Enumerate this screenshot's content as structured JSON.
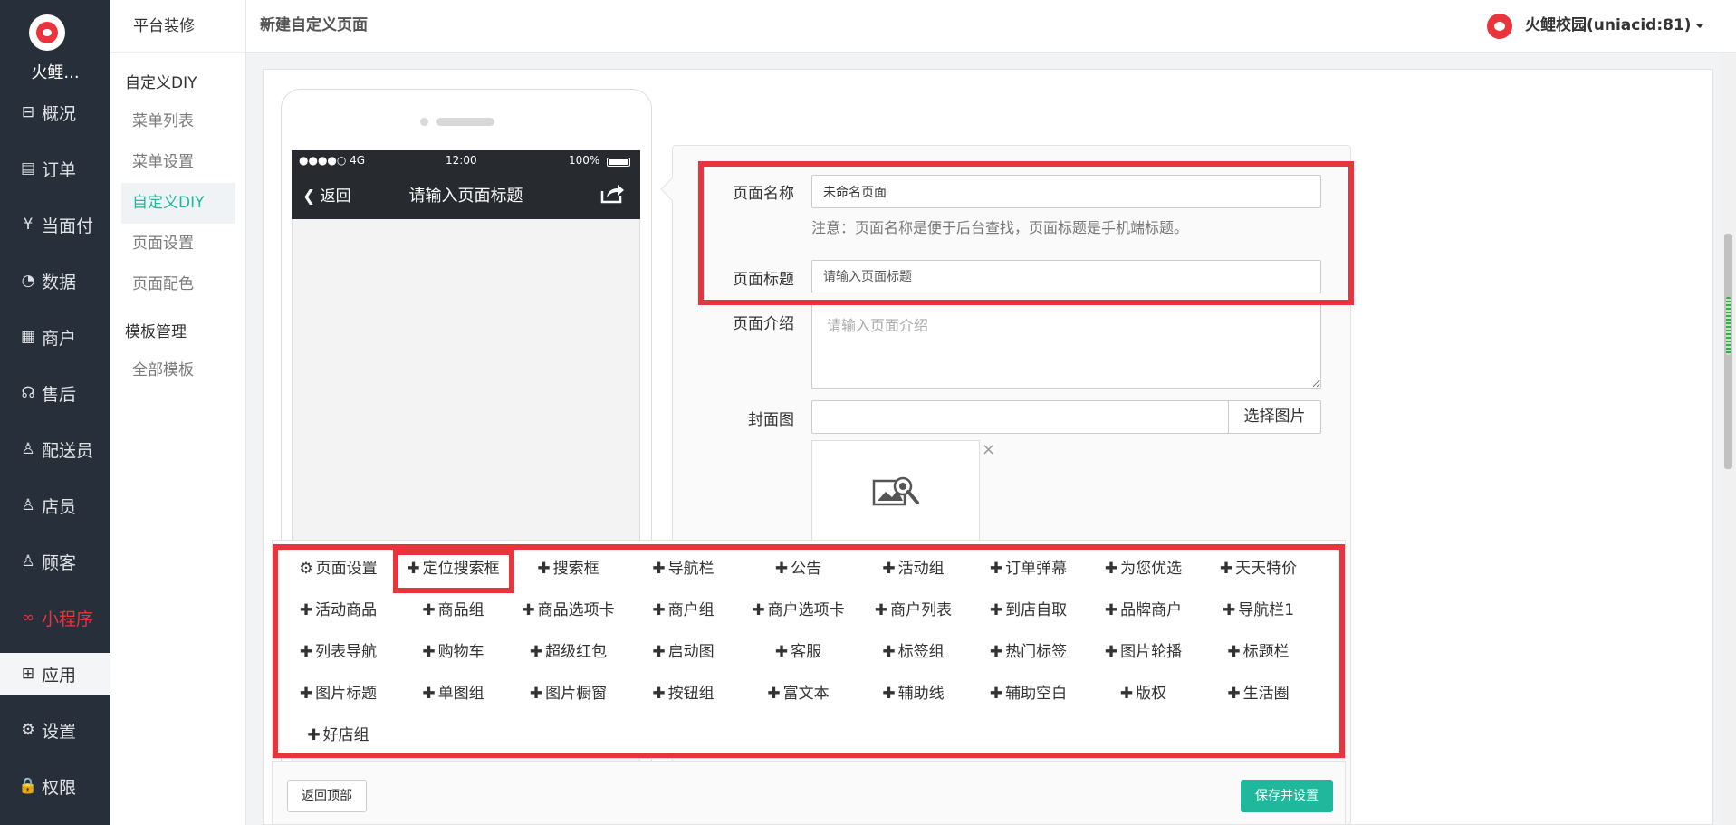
{
  "sidebar": {
    "brand": "火鲤...",
    "items": [
      {
        "label": "概况",
        "icon": "dashboard-icon",
        "glyph": "⊟"
      },
      {
        "label": "订单",
        "icon": "order-icon",
        "glyph": "▤"
      },
      {
        "label": "当面付",
        "icon": "yen-icon",
        "glyph": "¥"
      },
      {
        "label": "数据",
        "icon": "chart-icon",
        "glyph": "◔"
      },
      {
        "label": "商户",
        "icon": "store-icon",
        "glyph": "▦"
      },
      {
        "label": "售后",
        "icon": "service-icon",
        "glyph": "☊"
      },
      {
        "label": "配送员",
        "icon": "courier-icon",
        "glyph": "♙"
      },
      {
        "label": "店员",
        "icon": "clerk-icon",
        "glyph": "♙"
      },
      {
        "label": "顾客",
        "icon": "customer-icon",
        "glyph": "♙"
      },
      {
        "label": "小程序",
        "icon": "miniprogram-icon",
        "glyph": "∞"
      },
      {
        "label": "应用",
        "icon": "apps-icon",
        "glyph": "⊞"
      },
      {
        "label": "设置",
        "icon": "settings-icon",
        "glyph": "⚙"
      },
      {
        "label": "权限",
        "icon": "lock-icon",
        "glyph": "🔒"
      }
    ]
  },
  "subnav": {
    "title": "平台装修",
    "group1": "自定义DIY",
    "group1_items": [
      "菜单列表",
      "菜单设置",
      "自定义DIY",
      "页面设置",
      "页面配色"
    ],
    "group2": "模板管理",
    "group2_items": [
      "全部模板"
    ]
  },
  "header": {
    "title": "新建自定义页面",
    "user": "火鲤校园(uniacid:81)"
  },
  "phone": {
    "signal": "●●●●○ 4G",
    "time": "12:00",
    "battery": "100%",
    "back": "返回",
    "nav_title": "请输入页面标题"
  },
  "form": {
    "name_label": "页面名称",
    "name_value": "未命名页面",
    "name_note": "注意：页面名称是便于后台查找，页面标题是手机端标题。",
    "title_label": "页面标题",
    "title_placeholder": "请输入页面标题",
    "intro_label": "页面介绍",
    "intro_placeholder": "请输入页面介绍",
    "cover_label": "封面图",
    "cover_button": "选择图片",
    "close_glyph": "×"
  },
  "components": [
    "页面设置",
    "定位搜索框",
    "搜索框",
    "导航栏",
    "公告",
    "活动组",
    "订单弹幕",
    "为您优选",
    "天天特价",
    "活动商品",
    "商品组",
    "商品选项卡",
    "商户组",
    "商户选项卡",
    "商户列表",
    "到店自取",
    "品牌商户",
    "导航栏1",
    "列表导航",
    "购物车",
    "超级红包",
    "启动图",
    "客服",
    "标签组",
    "热门标签",
    "图片轮播",
    "标题栏",
    "图片标题",
    "单图组",
    "图片橱窗",
    "按钮组",
    "富文本",
    "辅助线",
    "辅助空白",
    "版权",
    "生活圈",
    "好店组"
  ],
  "footer": {
    "back_top": "返回顶部",
    "save": "保存并设置"
  },
  "colors": {
    "sidebar_bg": "#27303a",
    "accent_green": "#1fb89c",
    "highlight_red": "#e8343d"
  }
}
